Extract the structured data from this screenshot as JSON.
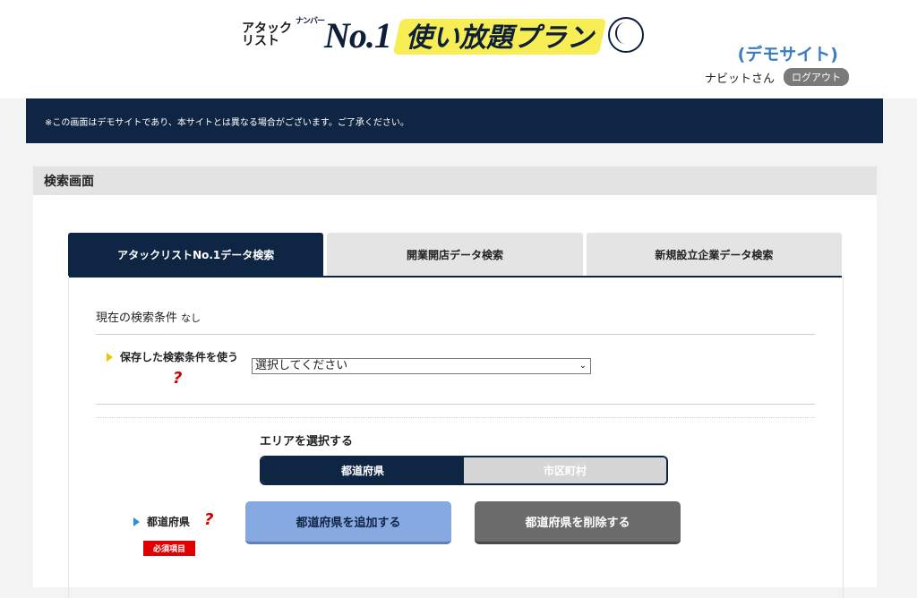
{
  "header": {
    "logo": {
      "small_line1": "アタック",
      "small_line2": "リスト",
      "no1": "No.1",
      "no1_ruby": "ナンバー",
      "plan": "使い放題プラン"
    },
    "demo_site": "(デモサイト)",
    "user_name": "ナビットさん",
    "logout_label": "ログアウト"
  },
  "notice": "※この画面はデモサイトであり、本サイトとは異なる場合がございます。ご了承ください。",
  "panel": {
    "title": "検索画面",
    "tabs": [
      {
        "label": "アタックリストNo.1データ検索",
        "active": true
      },
      {
        "label": "開業開店データ検索",
        "active": false
      },
      {
        "label": "新規設立企業データ検索",
        "active": false
      }
    ],
    "current_condition": {
      "label": "現在の検索条件",
      "value": "なし"
    },
    "saved_conditions": {
      "label": "保存した検索条件を使う",
      "select_value": "選択してください",
      "help": "?"
    },
    "area": {
      "heading": "エリアを選択する",
      "options": [
        {
          "label": "都道府県",
          "selected": true
        },
        {
          "label": "市区町村",
          "selected": false
        }
      ]
    },
    "prefecture": {
      "label": "都道府県",
      "help": "?",
      "required": "必須項目",
      "add_button": "都道府県を追加する",
      "delete_button": "都道府県を削除する"
    }
  },
  "colors": {
    "navy": "#0e2544",
    "demo_blue": "#3b7bc2",
    "add_button": "#87a9e2",
    "delete_button": "#6b6b6b",
    "required_red": "#e10000",
    "logo_yellow": "#f7ee55"
  }
}
